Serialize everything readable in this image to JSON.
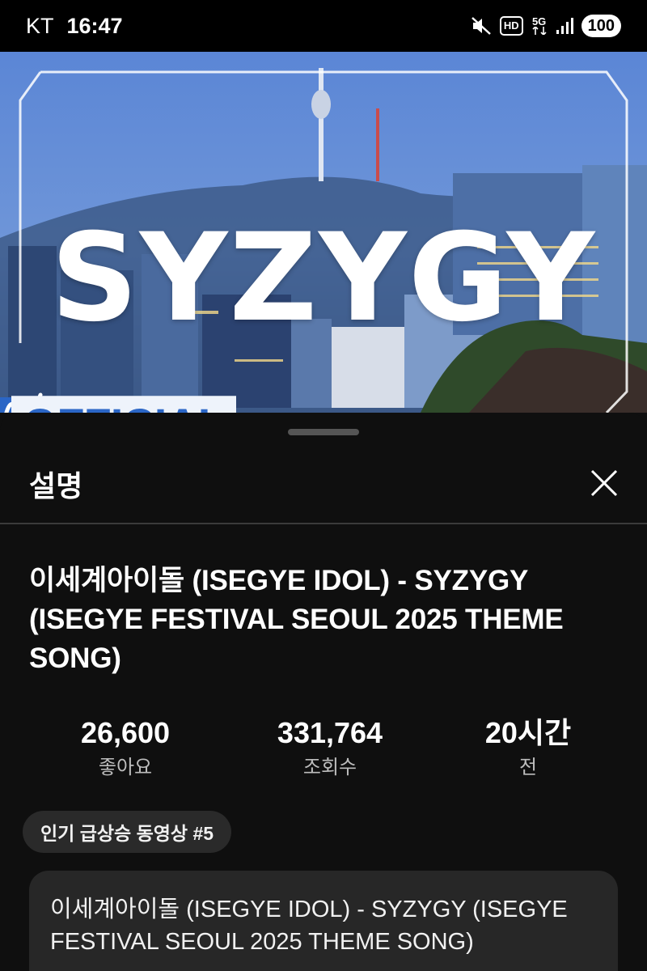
{
  "status_bar": {
    "carrier": "KT",
    "time": "16:47",
    "hd_badge": "HD",
    "network": "5G",
    "battery": "100",
    "icons": [
      "mute-icon",
      "hd-icon",
      "5g-icon",
      "signal-icon",
      "battery-icon"
    ]
  },
  "video": {
    "thumbnail_title": "SYZYGY",
    "badge_text": "OFFICIAL",
    "logo_text": "ᄋᄀᄋ"
  },
  "sheet": {
    "title": "설명",
    "close_icon": "close-icon",
    "video_title": "이세계아이돌 (ISEGYE IDOL) - SYZYGY (ISEGYE FESTIVAL SEOUL 2025 THEME SONG)",
    "stats": [
      {
        "value": "26,600",
        "label": "좋아요"
      },
      {
        "value": "331,764",
        "label": "조회수"
      },
      {
        "value": "20시간",
        "label": "전"
      }
    ],
    "trending_chip": "인기 급상승 동영상 #5",
    "description": "이세계아이돌 (ISEGYE IDOL) - SYZYGY (ISEGYE FESTIVAL SEOUL 2025 THEME SONG)"
  },
  "colors": {
    "background": "#0f0f0f",
    "chip": "#2a2a2a",
    "description_box": "#272727",
    "official_blue": "#2b66c6"
  }
}
